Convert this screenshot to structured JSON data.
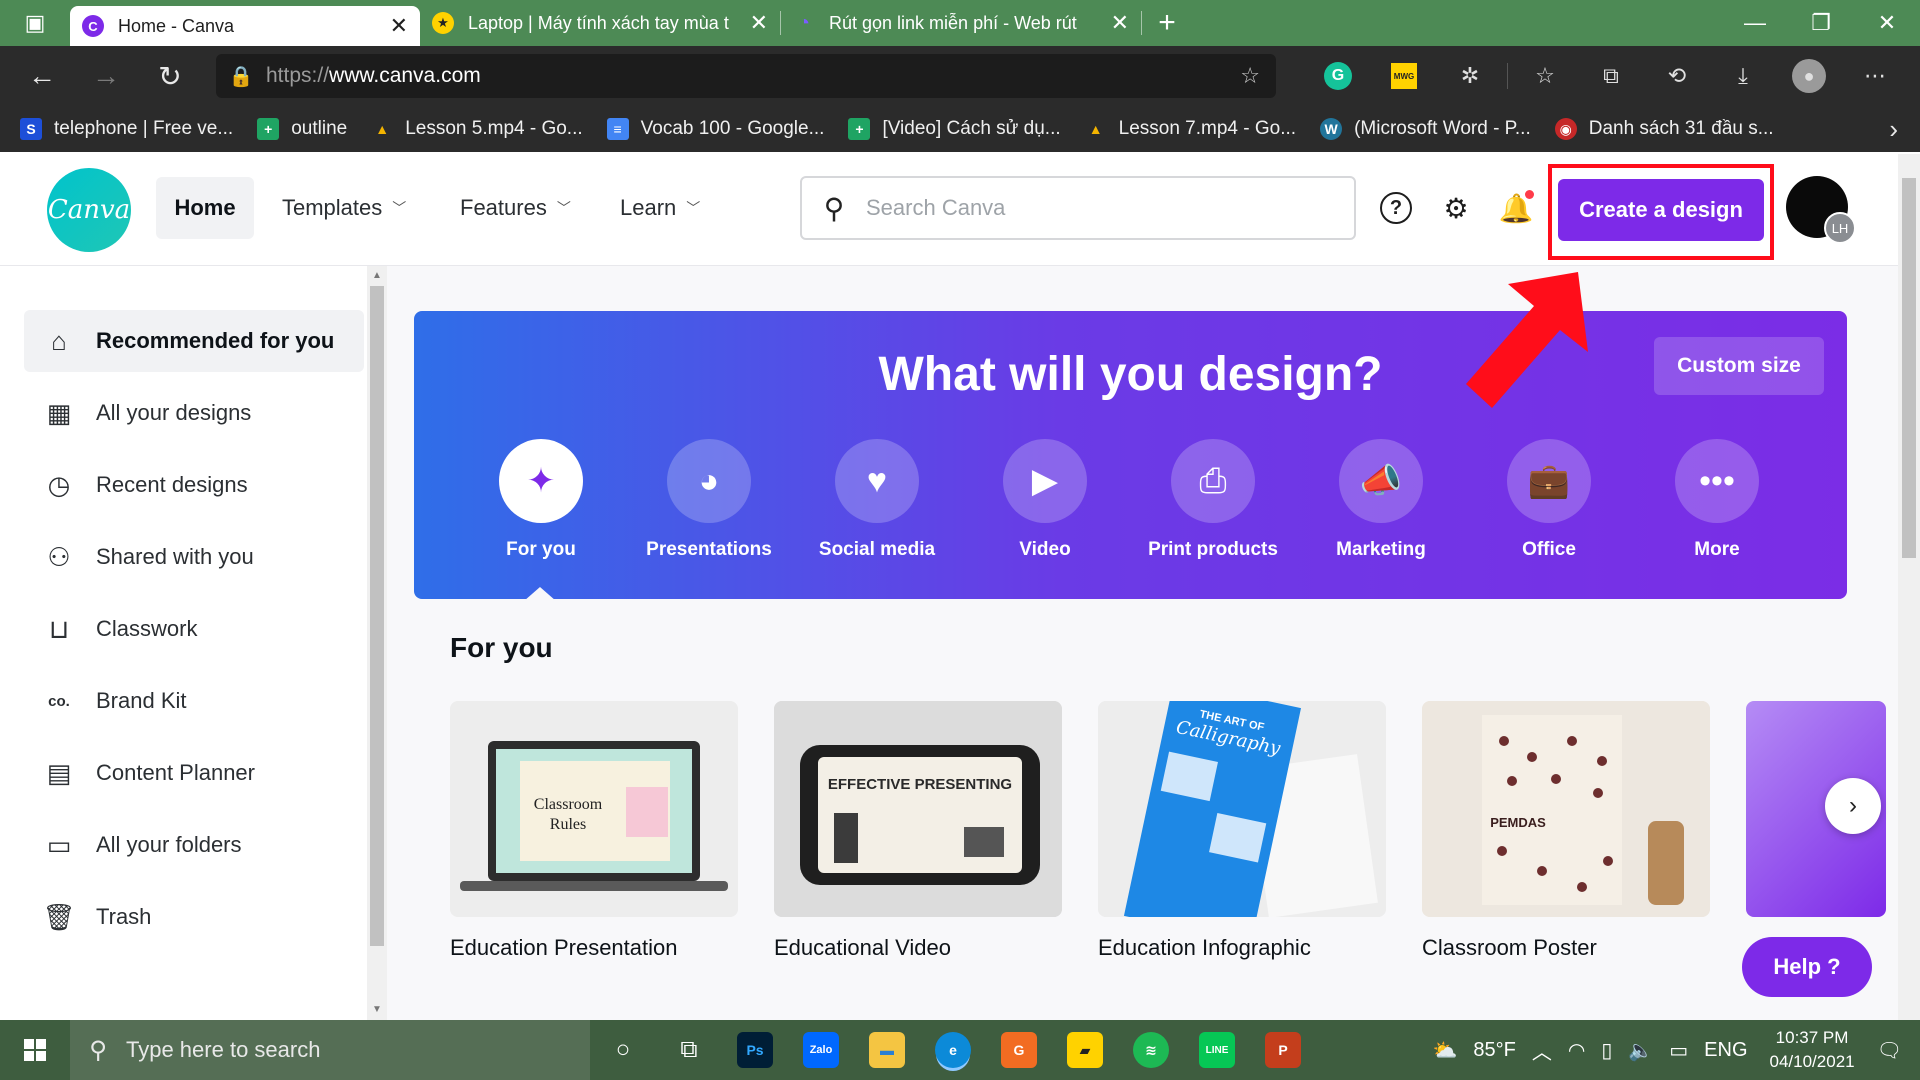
{
  "browser": {
    "tabs": [
      {
        "title": "Home - Canva",
        "favicon": "C",
        "favicon_color": "#7d2ae8",
        "active": true
      },
      {
        "title": "Laptop | Máy tính xách tay mùa t",
        "favicon": "★",
        "favicon_color": "#ffd200",
        "active": false
      },
      {
        "title": "Rút gọn link miễn phí - Web rút",
        "favicon": "◔",
        "favicon_color": "#7b5cff",
        "active": false
      }
    ],
    "address": {
      "scheme": "https://",
      "host": "www.canva.com"
    },
    "bookmarks": [
      {
        "label": "telephone | Free ve...",
        "icon": "S",
        "color": "#1d4fd8"
      },
      {
        "label": "outline",
        "icon": "+",
        "color": "#1fa463"
      },
      {
        "label": "Lesson 5.mp4 - Go...",
        "icon": "▲",
        "color": "#f4b400"
      },
      {
        "label": "Vocab 100 - Google...",
        "icon": "≡",
        "color": "#4285f4"
      },
      {
        "label": "[Video] Cách sử dụ...",
        "icon": "+",
        "color": "#1fa463"
      },
      {
        "label": "Lesson 7.mp4 - Go...",
        "icon": "▲",
        "color": "#f4b400"
      },
      {
        "label": "(Microsoft Word - P...",
        "icon": "W",
        "color": "#21759b"
      },
      {
        "label": "Danh sách 31 đầu s...",
        "icon": "◉",
        "color": "#c62828"
      }
    ]
  },
  "header": {
    "logo_text": "Canva",
    "nav": {
      "home": "Home",
      "templates": "Templates",
      "features": "Features",
      "learn": "Learn"
    },
    "search_placeholder": "Search Canva",
    "create_label": "Create a design",
    "avatar_initials": "LH"
  },
  "sidebar": {
    "items": [
      {
        "label": "Recommended for you",
        "icon": "home-icon"
      },
      {
        "label": "All your designs",
        "icon": "grid-icon"
      },
      {
        "label": "Recent designs",
        "icon": "clock-icon"
      },
      {
        "label": "Shared with you",
        "icon": "people-icon"
      },
      {
        "label": "Classwork",
        "icon": "inbox-icon"
      },
      {
        "label": "Brand Kit",
        "icon": "brand-icon"
      },
      {
        "label": "Content Planner",
        "icon": "calendar-icon"
      },
      {
        "label": "All your folders",
        "icon": "folder-icon"
      },
      {
        "label": "Trash",
        "icon": "trash-icon"
      }
    ]
  },
  "hero": {
    "title": "What will you design?",
    "custom_size": "Custom size",
    "categories": [
      {
        "label": "For you",
        "icon": "✦"
      },
      {
        "label": "Presentations",
        "icon": "◕"
      },
      {
        "label": "Social media",
        "icon": "♥"
      },
      {
        "label": "Video",
        "icon": "▶"
      },
      {
        "label": "Print products",
        "icon": "⎙"
      },
      {
        "label": "Marketing",
        "icon": "📣"
      },
      {
        "label": "Office",
        "icon": "💼"
      },
      {
        "label": "More",
        "icon": "•••"
      }
    ]
  },
  "for_you": {
    "heading": "For you",
    "cards": [
      {
        "label": "Education Presentation",
        "thumb_text": "Classroom Rules"
      },
      {
        "label": "Educational Video",
        "thumb_text": "EFFECTIVE PRESENTING"
      },
      {
        "label": "Education Infographic",
        "thumb_text": "THE ART OF Calligraphy"
      },
      {
        "label": "Classroom Poster",
        "thumb_text": "PEMDAS"
      }
    ]
  },
  "help_label": "Help ?",
  "taskbar": {
    "search_placeholder": "Type here to search",
    "weather": "85°F",
    "lang": "ENG",
    "time": "10:37 PM",
    "date": "04/10/2021"
  }
}
